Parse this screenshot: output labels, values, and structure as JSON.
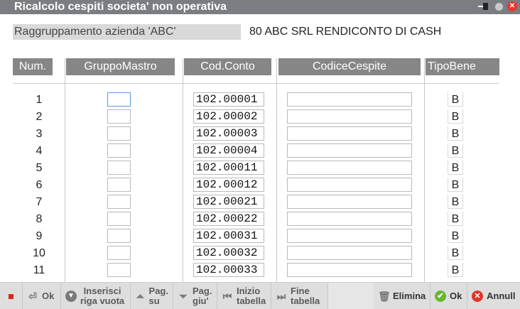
{
  "window": {
    "title": "Ricalcolo cespiti societa' non operativa",
    "controls": [
      "pin-icon",
      "minimize-dot-icon",
      "close-icon"
    ]
  },
  "info": {
    "label": "Raggruppamento azienda 'ABC'",
    "value": "80 ABC SRL RENDICONTO DI CASH"
  },
  "table": {
    "columns": [
      "Num.",
      "GruppoMastro",
      "Cod.Conto",
      "CodiceCespite",
      "TipoBene"
    ],
    "rows": [
      {
        "num": "1",
        "gruppo": "",
        "cod": "102.00001",
        "cespite": "",
        "tipo": "B"
      },
      {
        "num": "2",
        "gruppo": "",
        "cod": "102.00002",
        "cespite": "",
        "tipo": "B"
      },
      {
        "num": "3",
        "gruppo": "",
        "cod": "102.00003",
        "cespite": "",
        "tipo": "B"
      },
      {
        "num": "4",
        "gruppo": "",
        "cod": "102.00004",
        "cespite": "",
        "tipo": "B"
      },
      {
        "num": "5",
        "gruppo": "",
        "cod": "102.00011",
        "cespite": "",
        "tipo": "B"
      },
      {
        "num": "6",
        "gruppo": "",
        "cod": "102.00012",
        "cespite": "",
        "tipo": "B"
      },
      {
        "num": "7",
        "gruppo": "",
        "cod": "102.00021",
        "cespite": "",
        "tipo": "B"
      },
      {
        "num": "8",
        "gruppo": "",
        "cod": "102.00022",
        "cespite": "",
        "tipo": "B"
      },
      {
        "num": "9",
        "gruppo": "",
        "cod": "102.00031",
        "cespite": "",
        "tipo": "B"
      },
      {
        "num": "10",
        "gruppo": "",
        "cod": "102.00032",
        "cespite": "",
        "tipo": "B"
      },
      {
        "num": "11",
        "gruppo": "",
        "cod": "102.00033",
        "cespite": "",
        "tipo": "B"
      }
    ]
  },
  "toolbar": {
    "ok_label": "Ok",
    "inserisci_label": "Inserisci\nriga vuota",
    "pag_su_label": "Pag.\nsu",
    "pag_giu_label": "Pag.\ngiu'",
    "inizio_label": "Inizio\ntabella",
    "fine_label": "Fine\ntabella",
    "elimina_label": "Elimina",
    "ok2_label": "Ok",
    "annulla_label": "Annull"
  },
  "colors": {
    "titlebar": "#7a7d82",
    "header": "#868686",
    "close_red": "#e8362c",
    "ok_green": "#6ab734",
    "stop_red": "#e2231a"
  }
}
